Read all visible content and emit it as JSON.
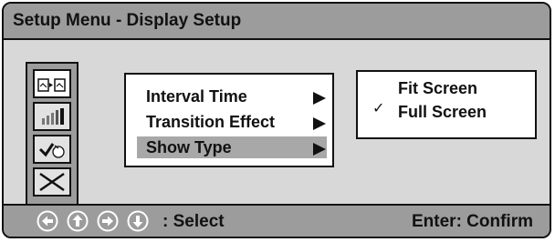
{
  "window": {
    "title": "Setup Menu - Display Setup"
  },
  "sidebar": {
    "icons": [
      {
        "name": "slideshow-icon",
        "selected": true
      },
      {
        "name": "level-bars-icon",
        "selected": false
      },
      {
        "name": "checkmark-icon",
        "selected": false
      },
      {
        "name": "exit-icon",
        "selected": false
      }
    ]
  },
  "menu": {
    "items": [
      {
        "label": "Interval Time",
        "highlighted": false
      },
      {
        "label": "Transition Effect",
        "highlighted": false
      },
      {
        "label": "Show Type",
        "highlighted": true
      }
    ]
  },
  "submenu": {
    "options": [
      {
        "label": "Fit Screen",
        "checked": false
      },
      {
        "label": "Full Screen",
        "checked": true
      }
    ],
    "check_glyph": "✓"
  },
  "footer": {
    "nav_icons": [
      "arrow-left-icon",
      "arrow-up-icon",
      "arrow-right-icon",
      "arrow-down-icon"
    ],
    "select_label": ": Select",
    "confirm_label": "Enter: Confirm"
  },
  "colors": {
    "panel": "#d8d8d8",
    "bar": "#9c9c9c",
    "highlight": "#a8a8a8"
  }
}
